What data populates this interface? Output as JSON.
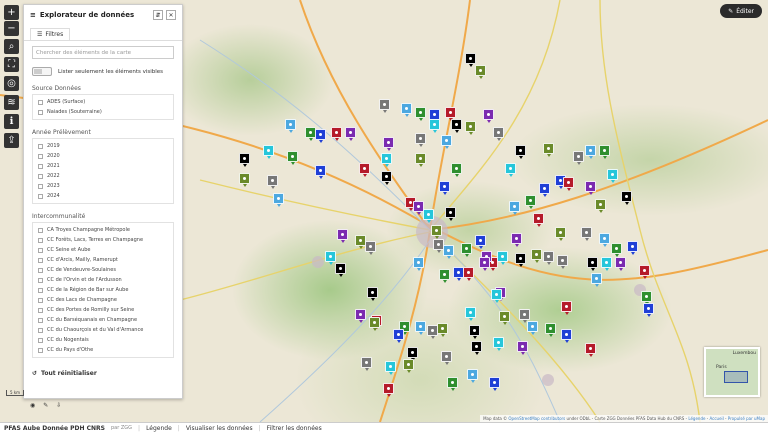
{
  "edit_button": {
    "label": "Éditer"
  },
  "panel": {
    "title": "Explorateur de données",
    "tab": "Filtres",
    "search_placeholder": "Chercher des éléments de la carte",
    "toggle_label": "Lister seulement les éléments visibles",
    "sections": [
      {
        "title": "Source Données",
        "items": [
          "ADES (Surface)",
          "Naiades (Souterraine)"
        ]
      },
      {
        "title": "Année Prélèvement",
        "items": [
          "2019",
          "2020",
          "2021",
          "2022",
          "2023",
          "2024"
        ]
      },
      {
        "title": "Intercommunalité",
        "items": [
          "CA Troyes Champagne Métropole",
          "CC Forêts, Lacs, Terres en Champagne",
          "CC Seine et Aube",
          "CC d'Arcis, Mailly, Ramerupt",
          "CC de Vendeuvre-Soulaines",
          "CC de l'Orvin et de l'Ardusson",
          "CC de la Région de Bar sur Aube",
          "CC des Lacs de Champagne",
          "CC des Portes de Romilly sur Seine",
          "CC du Barséquanais en Champagne",
          "CC du Chaourçois et du Val d'Armance",
          "CC du Nogentais",
          "CC du Pays d'Othe"
        ]
      }
    ],
    "reset_label": "Tout réinitialiser"
  },
  "minimap": {
    "labels": [
      "Luxembou",
      "Paris"
    ]
  },
  "scale": {
    "label": "5 km"
  },
  "attribution": {
    "prefix": "Map data ©",
    "link": "OpenStreetMap contributors",
    "rest": "under ODbL - Carte ZGG Données PFAS Data Hub du CNRS -",
    "links": [
      "Légende",
      "Accueil",
      "Propulsé par uMap"
    ]
  },
  "footer": {
    "app_name": "PFAS Aube Donnée PDH CNRS",
    "by": "par ZGG",
    "links": [
      "Légende",
      "Visualiser les données",
      "Filtrer les données"
    ]
  },
  "colors": {
    "marker_palette": [
      "#000000",
      "#1f3fd6",
      "#2f8f2f",
      "#4ca8e0",
      "#26c6da",
      "#7b2ab0",
      "#b51a2a",
      "#777777",
      "#6a8a2a"
    ]
  }
}
